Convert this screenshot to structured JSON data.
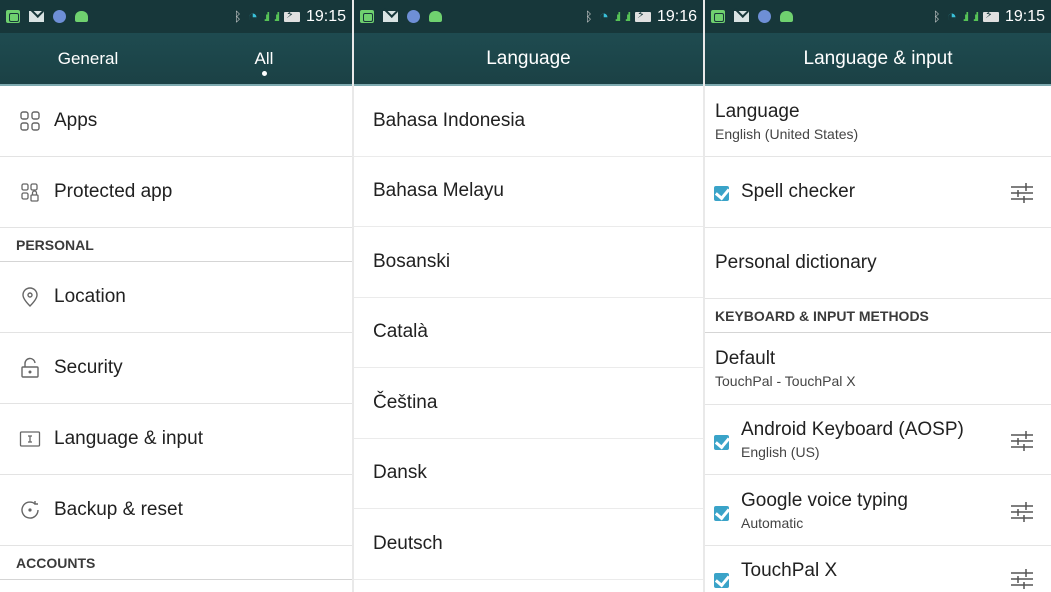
{
  "screen1": {
    "status": {
      "time": "19:15"
    },
    "tabs": [
      {
        "label": "General"
      },
      {
        "label": "All",
        "active": true
      }
    ],
    "items_top": [
      {
        "label": "Apps",
        "icon": "apps-grid-icon"
      },
      {
        "label": "Protected app",
        "icon": "protected-app-icon"
      }
    ],
    "section_personal": "PERSONAL",
    "items_personal": [
      {
        "label": "Location",
        "icon": "location-pin-icon"
      },
      {
        "label": "Security",
        "icon": "lock-icon"
      },
      {
        "label": "Language & input",
        "icon": "text-input-icon"
      },
      {
        "label": "Backup & reset",
        "icon": "backup-icon"
      }
    ],
    "section_accounts": "ACCOUNTS"
  },
  "screen2": {
    "status": {
      "time": "19:16"
    },
    "title": "Language",
    "languages": [
      "Bahasa Indonesia",
      "Bahasa Melayu",
      "Bosanski",
      "Català",
      "Čeština",
      "Dansk",
      "Deutsch"
    ]
  },
  "screen3": {
    "status": {
      "time": "19:15"
    },
    "title": "Language & input",
    "language": {
      "title": "Language",
      "value": "English (United States)"
    },
    "spell_checker": {
      "label": "Spell checker",
      "checked": true
    },
    "personal_dictionary": "Personal dictionary",
    "section_keyboard": "KEYBOARD & INPUT METHODS",
    "default": {
      "title": "Default",
      "value": "TouchPal - TouchPal X"
    },
    "input_methods": [
      {
        "name": "Android Keyboard (AOSP)",
        "sub": "English (US)",
        "checked": true
      },
      {
        "name": "Google voice typing",
        "sub": "Automatic",
        "checked": true
      },
      {
        "name": "TouchPal X",
        "sub": "",
        "checked": true
      }
    ]
  },
  "colors": {
    "statusbar": "#17373a",
    "actionbar": "#1c4448",
    "checkbox": "#3aa3c8"
  }
}
